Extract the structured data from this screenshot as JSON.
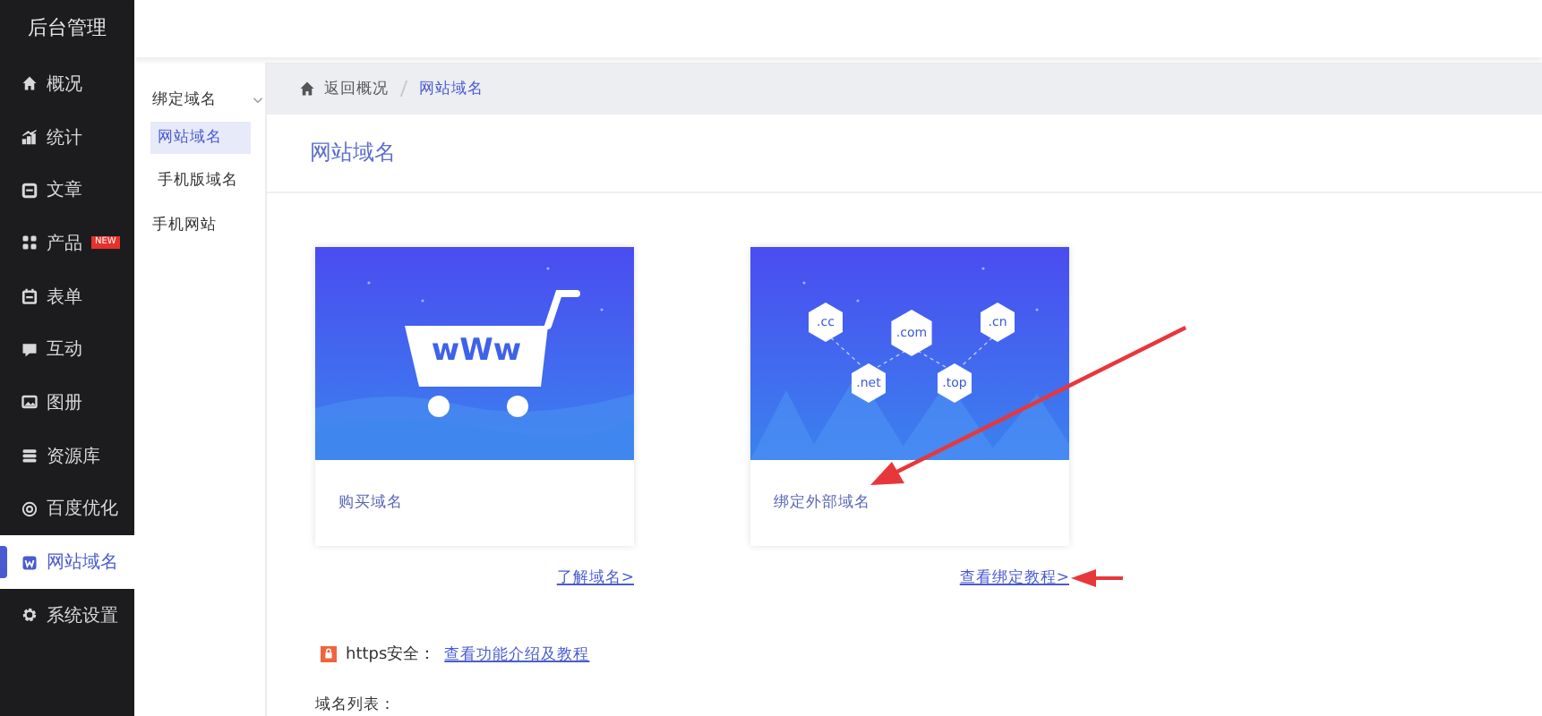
{
  "sidebar": {
    "title": "后台管理",
    "items": [
      {
        "label": "概况",
        "selected": false
      },
      {
        "label": "统计",
        "selected": false
      },
      {
        "label": "文章",
        "selected": false
      },
      {
        "label": "产品",
        "selected": false,
        "badge": "NEW"
      },
      {
        "label": "表单",
        "selected": false
      },
      {
        "label": "互动",
        "selected": false
      },
      {
        "label": "图册",
        "selected": false
      },
      {
        "label": "资源库",
        "selected": false
      },
      {
        "label": "百度优化",
        "selected": false
      },
      {
        "label": "网站域名",
        "selected": true
      },
      {
        "label": "系统设置",
        "selected": false
      }
    ]
  },
  "subnav": {
    "group": {
      "label": "绑定域名",
      "expanded": true,
      "items": [
        {
          "label": "网站域名",
          "selected": true
        },
        {
          "label": "手机版域名",
          "selected": false
        }
      ]
    },
    "items": [
      {
        "label": "手机网站",
        "selected": false
      }
    ]
  },
  "breadcrumb": [
    {
      "label": "返回概况"
    },
    {
      "label": "网站域名"
    }
  ],
  "page_title": "网站域名",
  "cards": [
    {
      "kind": "cart",
      "label": "购买域名",
      "cart_text": "wWw",
      "link": "了解域名>"
    },
    {
      "kind": "domains",
      "label": "绑定外部域名",
      "tags": [
        ".cc",
        ".com",
        ".cn",
        ".net",
        ".top"
      ],
      "link": "查看绑定教程>"
    }
  ],
  "https": {
    "label": "https安全：",
    "link": "查看功能介绍及教程"
  },
  "list_label": "域名列表："
}
